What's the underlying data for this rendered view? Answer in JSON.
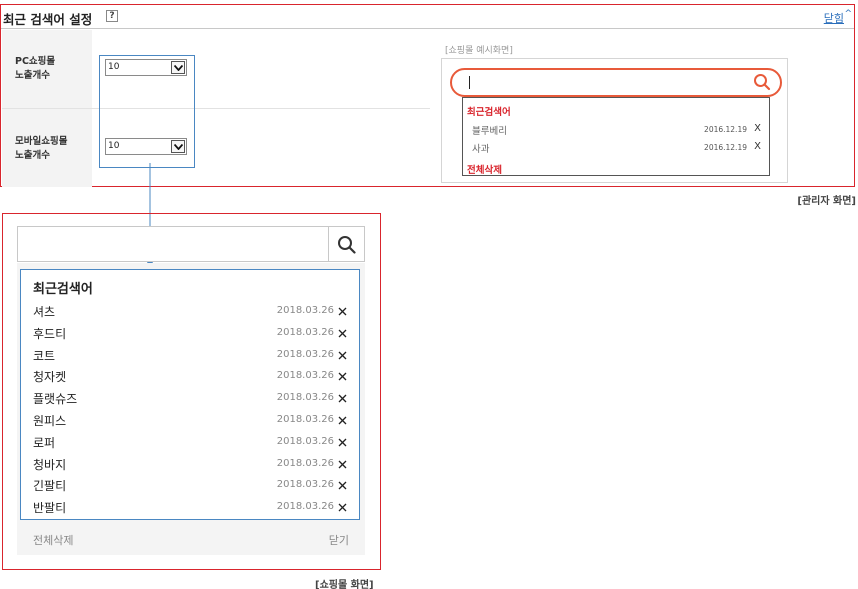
{
  "admin": {
    "title": "최근 검색어 설정",
    "help_label": "?",
    "close_label": "닫힘",
    "close_caret": "^",
    "rows": [
      {
        "label_line1": "PC쇼핑몰",
        "label_line2": "노출개수",
        "value": "10"
      },
      {
        "label_line1": "모바일쇼핑몰",
        "label_line2": "노출개수",
        "value": "10"
      }
    ],
    "preview": {
      "label": "[쇼핑몰 예시화면]",
      "title": "최근검색어",
      "items": [
        {
          "term": "블루베리",
          "date": "2016.12.19",
          "remove": "X"
        },
        {
          "term": "사과",
          "date": "2016.12.19",
          "remove": "X"
        }
      ],
      "clear_all": "전체삭제"
    },
    "caption": "[관리자 화면]"
  },
  "shop": {
    "title": "최근검색어",
    "items": [
      {
        "term": "셔츠",
        "date": "2018.03.26"
      },
      {
        "term": "후드티",
        "date": "2018.03.26"
      },
      {
        "term": "코트",
        "date": "2018.03.26"
      },
      {
        "term": "청자켓",
        "date": "2018.03.26"
      },
      {
        "term": "플랫슈즈",
        "date": "2018.03.26"
      },
      {
        "term": "원피스",
        "date": "2018.03.26"
      },
      {
        "term": "로퍼",
        "date": "2018.03.26"
      },
      {
        "term": "청바지",
        "date": "2018.03.26"
      },
      {
        "term": "긴팔티",
        "date": "2018.03.26"
      },
      {
        "term": "반팔티",
        "date": "2018.03.26"
      }
    ],
    "clear_all": "전체삭제",
    "close": "닫기",
    "caption": "[쇼핑몰 화면]"
  },
  "colors": {
    "frame_red": "#d9252d",
    "frame_blue": "#4a87c2",
    "search_orange": "#e85a3a",
    "link_blue": "#2a6ebb"
  },
  "icons": [
    "help-icon",
    "select-arrow-icon",
    "search-icon",
    "close-icon",
    "connector-arrow-icon"
  ]
}
